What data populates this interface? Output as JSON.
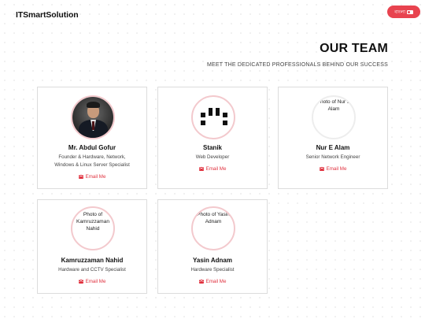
{
  "header": {
    "brand": "ITSmartSolution",
    "language_button": "বাংলা",
    "language_icon": "flag-icon",
    "accent_color": "#e8434f"
  },
  "section": {
    "title": "OUR TEAM",
    "subtitle": "MEET THE DEDICATED PROFESSIONALS BEHIND OUR SUCCESS"
  },
  "team": [
    {
      "name": "Mr. Abdul Gofur",
      "role_line1": "Founder & Hardware, Network,",
      "role_line2": "Windows & Linux Server Specialist",
      "email_label": "Email Me",
      "photo": "portrait-photo"
    },
    {
      "name": "Stanik",
      "role_line1": "Web Developer",
      "email_label": "Email Me",
      "photo": "logo-mark"
    },
    {
      "name": "Nur E Alam",
      "role_line1": "Senior Network Engineer",
      "email_label": "Email Me",
      "photo_alt": "Photo of Nur E Alam"
    },
    {
      "name": "Kamruzzaman Nahid",
      "role_line1": "Hardware and CCTV Specialist",
      "email_label": "Email Me",
      "photo_alt": "Photo of Kamruzzaman Nahid"
    },
    {
      "name": "Yasin Adnam",
      "role_line1": "Hardware Specialist",
      "email_label": "Email Me",
      "photo_alt": "Photo of Yasin Adnam"
    }
  ]
}
